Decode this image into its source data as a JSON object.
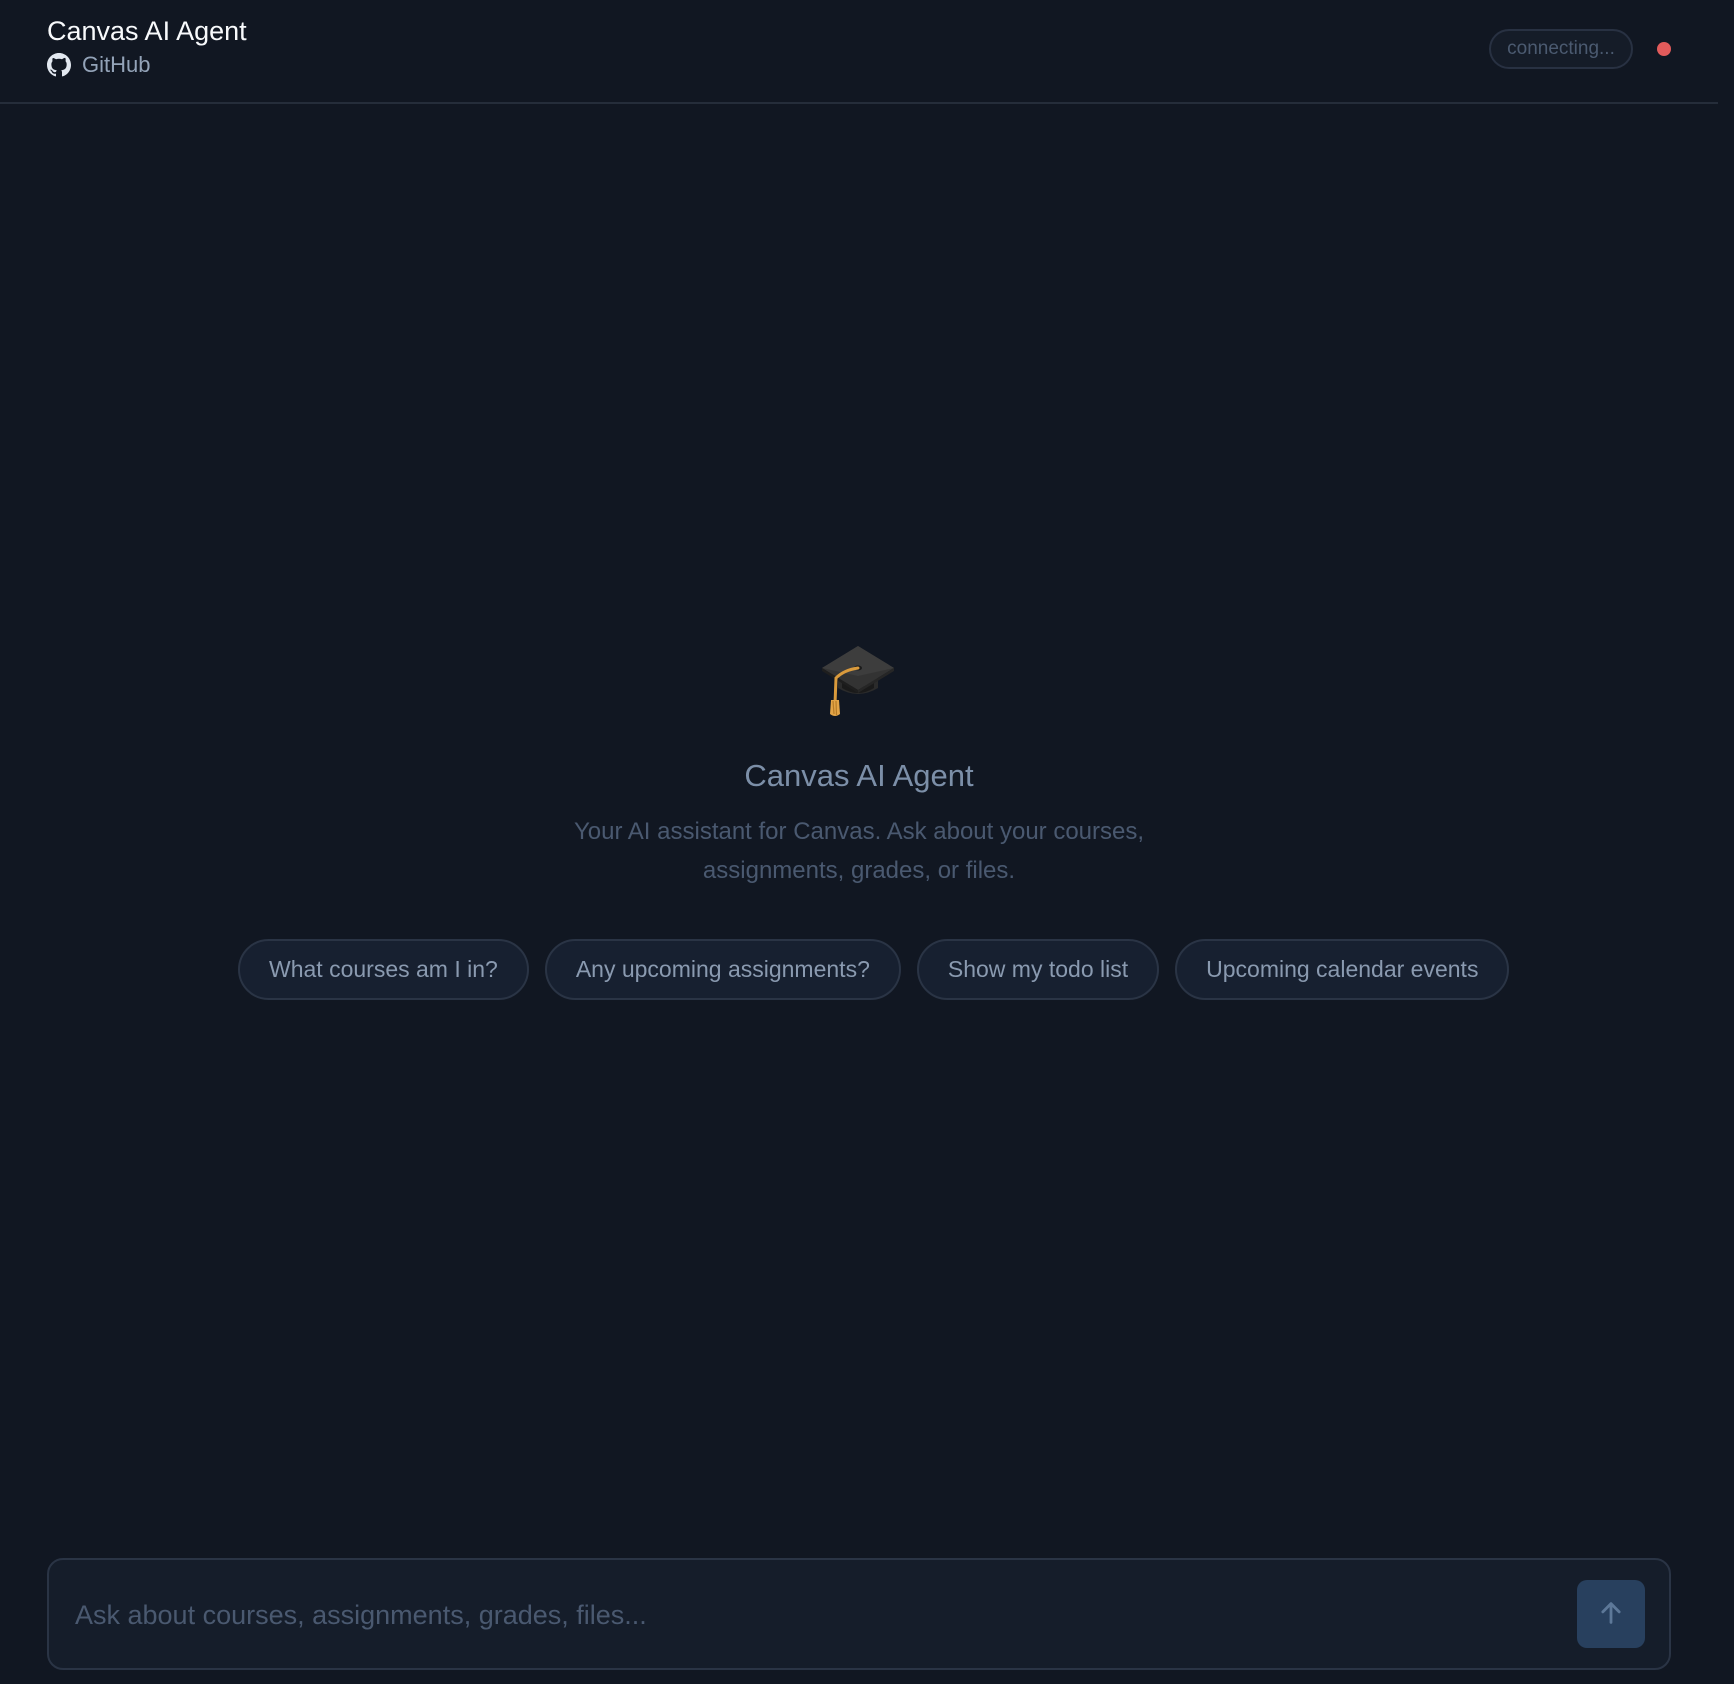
{
  "header": {
    "app_title": "Canvas AI Agent",
    "github_label": "GitHub",
    "github_icon": "github-icon",
    "status_label": "connecting...",
    "status_dot_color": "#e25b5b"
  },
  "hero": {
    "icon": "graduation-cap-icon",
    "title": "Canvas AI Agent",
    "subtitle": "Your AI assistant for Canvas. Ask about your courses, assignments, grades, or files."
  },
  "suggestions": [
    "What courses am I in?",
    "Any upcoming assignments?",
    "Show my todo list",
    "Upcoming calendar events"
  ],
  "composer": {
    "placeholder": "Ask about courses, assignments, grades, files...",
    "value": "",
    "send_icon": "arrow-up-icon"
  },
  "colors": {
    "background": "#111722",
    "accent_button": "#28405e",
    "status_error": "#e25b5b"
  }
}
